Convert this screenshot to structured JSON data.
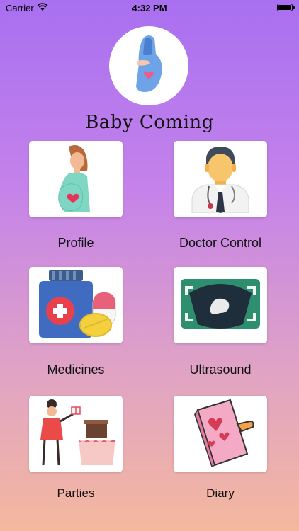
{
  "status": {
    "carrier": "Carrier",
    "time": "4:32 PM"
  },
  "app": {
    "title": "Baby Coming"
  },
  "menu": [
    {
      "label": "Profile"
    },
    {
      "label": "Doctor Control"
    },
    {
      "label": "Medicines"
    },
    {
      "label": "Ultrasound"
    },
    {
      "label": "Parties"
    },
    {
      "label": "Diary"
    }
  ],
  "icons": {
    "logo": "pregnant-belly-icon",
    "profile": "pregnant-woman-icon",
    "doctor": "doctor-icon",
    "medicines": "pills-bottle-icon",
    "ultrasound": "ultrasound-scan-icon",
    "parties": "party-cake-icon",
    "diary": "diary-book-icon"
  }
}
